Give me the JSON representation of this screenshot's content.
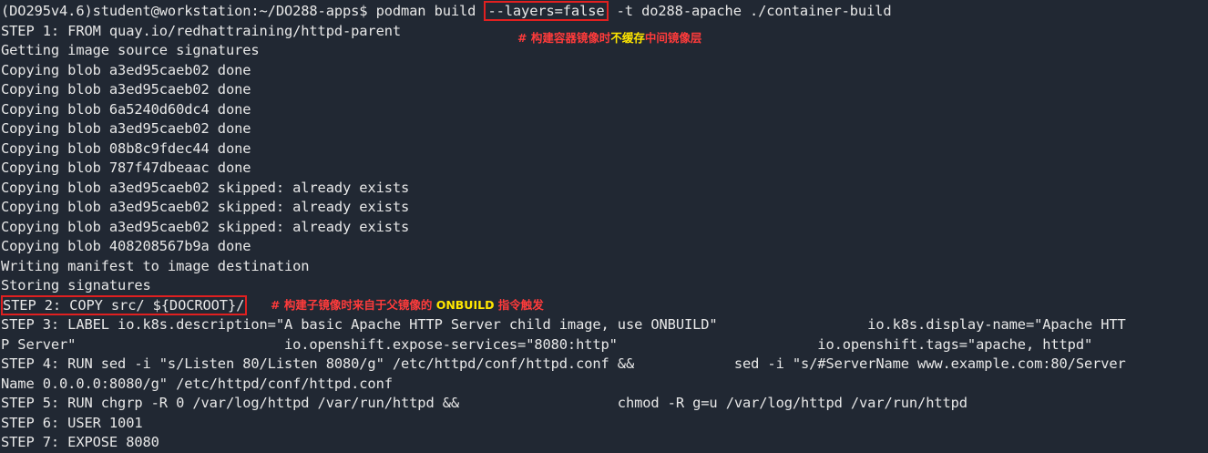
{
  "terminal": {
    "lines": [
      {
        "pre": "(DO295v4.6)student@workstation:~/DO288-apps$ podman build ",
        "boxed": "--layers=false",
        "post": " -t do288-apache ./container-build"
      },
      {
        "text": "STEP 1: FROM quay.io/redhattraining/httpd-parent"
      },
      {
        "text": "Getting image source signatures"
      },
      {
        "text": "Copying blob a3ed95caeb02 done"
      },
      {
        "text": "Copying blob a3ed95caeb02 done"
      },
      {
        "text": "Copying blob 6a5240d60dc4 done"
      },
      {
        "text": "Copying blob a3ed95caeb02 done"
      },
      {
        "text": "Copying blob 08b8c9fdec44 done"
      },
      {
        "text": "Copying blob 787f47dbeaac done"
      },
      {
        "text": "Copying blob a3ed95caeb02 skipped: already exists"
      },
      {
        "text": "Copying blob a3ed95caeb02 skipped: already exists"
      },
      {
        "text": "Copying blob a3ed95caeb02 skipped: already exists"
      },
      {
        "text": "Copying blob 408208567b9a done"
      },
      {
        "text": "Writing manifest to image destination"
      },
      {
        "text": "Storing signatures"
      },
      {
        "boxed": "STEP 2: COPY src/ ${DOCROOT}/"
      },
      {
        "text": "STEP 3: LABEL io.k8s.description=\"A basic Apache HTTP Server child image, use ONBUILD\"                  io.k8s.display-name=\"Apache HTT"
      },
      {
        "text": "P Server\"                         io.openshift.expose-services=\"8080:http\"                        io.openshift.tags=\"apache, httpd\""
      },
      {
        "text": "STEP 4: RUN sed -i \"s/Listen 80/Listen 8080/g\" /etc/httpd/conf/httpd.conf &&            sed -i \"s/#ServerName www.example.com:80/Server"
      },
      {
        "text": "Name 0.0.0.0:8080/g\" /etc/httpd/conf/httpd.conf"
      },
      {
        "text": "STEP 5: RUN chgrp -R 0 /var/log/httpd /var/run/httpd &&                   chmod -R g=u /var/log/httpd /var/run/httpd"
      },
      {
        "text": "STEP 6: USER 1001"
      },
      {
        "text": "STEP 7: EXPOSE 8080"
      }
    ]
  },
  "annotations": {
    "layers_note": {
      "a": "# 构建容器镜像时",
      "b": "不缓存",
      "c": "中间镜像层"
    },
    "onbuild_note": {
      "a": "# 构建子镜像时来自于父镜像的 ",
      "b": "ONBUILD",
      "c": " 指令触发"
    }
  }
}
